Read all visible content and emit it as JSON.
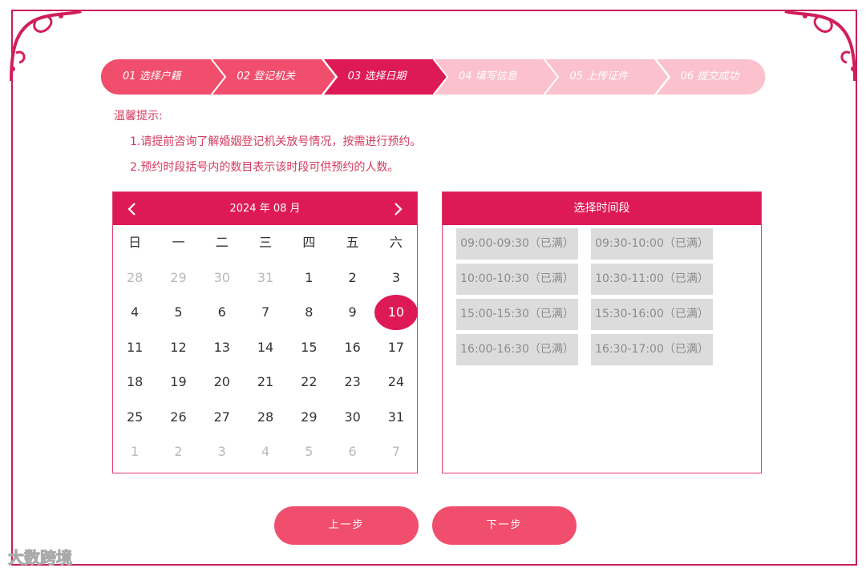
{
  "steps": [
    {
      "label": "01 选择户籍"
    },
    {
      "label": "02 登记机关"
    },
    {
      "label": "03 选择日期"
    },
    {
      "label": "04 填写信息"
    },
    {
      "label": "05 上传证件"
    },
    {
      "label": "06 提交成功"
    }
  ],
  "active_step": 3,
  "colors": {
    "accent": "#de1a56",
    "step_done": "#f04e6c",
    "step_todo": "#fbc1cd",
    "button": "#f04e6c",
    "tip_text": "#d63a5e"
  },
  "tips": {
    "title": "温馨提示:",
    "line1": "1.请提前咨询了解婚姻登记机关放号情况，按需进行预约。",
    "line2": "2.预约时段括号内的数目表示该时段可供预约的人数。"
  },
  "calendar": {
    "month_label": "2024 年 08 月",
    "prev_icon": "chevron-left-icon",
    "next_icon": "chevron-right-icon",
    "weekdays": [
      "日",
      "一",
      "二",
      "三",
      "四",
      "五",
      "六"
    ],
    "weeks": [
      [
        {
          "d": "28",
          "m": true
        },
        {
          "d": "29",
          "m": true
        },
        {
          "d": "30",
          "m": true
        },
        {
          "d": "31",
          "m": true
        },
        {
          "d": "1"
        },
        {
          "d": "2"
        },
        {
          "d": "3"
        }
      ],
      [
        {
          "d": "4"
        },
        {
          "d": "5"
        },
        {
          "d": "6"
        },
        {
          "d": "7"
        },
        {
          "d": "8"
        },
        {
          "d": "9"
        },
        {
          "d": "10",
          "s": true
        }
      ],
      [
        {
          "d": "11"
        },
        {
          "d": "12"
        },
        {
          "d": "13"
        },
        {
          "d": "14"
        },
        {
          "d": "15"
        },
        {
          "d": "16"
        },
        {
          "d": "17"
        }
      ],
      [
        {
          "d": "18"
        },
        {
          "d": "19"
        },
        {
          "d": "20"
        },
        {
          "d": "21"
        },
        {
          "d": "22"
        },
        {
          "d": "23"
        },
        {
          "d": "24"
        }
      ],
      [
        {
          "d": "25"
        },
        {
          "d": "26"
        },
        {
          "d": "27"
        },
        {
          "d": "28"
        },
        {
          "d": "29"
        },
        {
          "d": "30"
        },
        {
          "d": "31"
        }
      ],
      [
        {
          "d": "1",
          "m": true
        },
        {
          "d": "2",
          "m": true
        },
        {
          "d": "3",
          "m": true
        },
        {
          "d": "4",
          "m": true
        },
        {
          "d": "5",
          "m": true
        },
        {
          "d": "6",
          "m": true
        },
        {
          "d": "7",
          "m": true
        }
      ]
    ]
  },
  "timeslots": {
    "title": "选择时间段",
    "slots": [
      "09:00-09:30（已满）",
      "09:30-10:00（已满）",
      "10:00-10:30（已满）",
      "10:30-11:00（已满）",
      "15:00-15:30（已满）",
      "15:30-16:00（已满）",
      "16:00-16:30（已满）",
      "16:30-17:00（已满）"
    ]
  },
  "buttons": {
    "prev": "上一步",
    "next": "下一步"
  },
  "watermark": "大数跨境"
}
